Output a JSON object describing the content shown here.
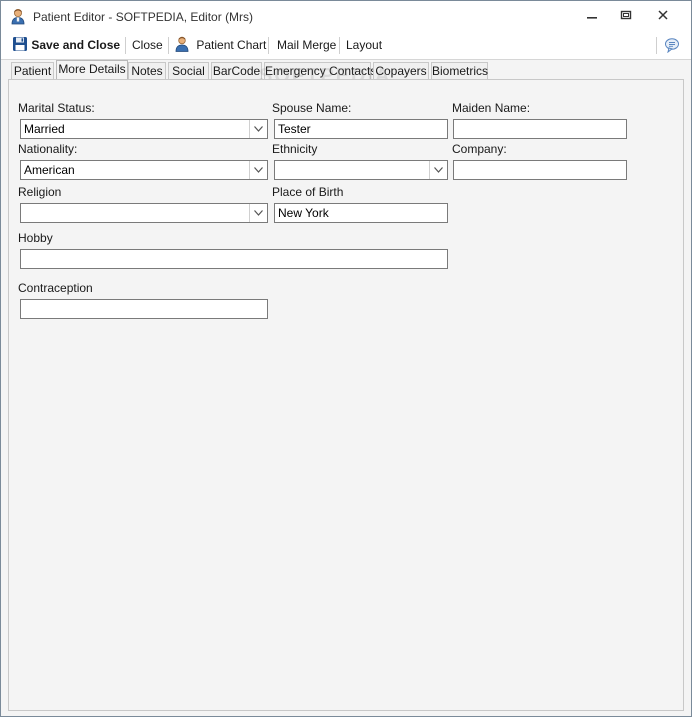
{
  "window": {
    "title": "Patient Editor - SOFTPEDIA, Editor (Mrs)",
    "minimize": "—",
    "restore": "⧉",
    "close": "✕"
  },
  "toolbar": {
    "save_close_label": "Save and Close",
    "close_label": "Close",
    "patient_chart_label": "Patient Chart",
    "mail_merge_label": "Mail Merge",
    "layout_label": "Layout"
  },
  "tabs": [
    {
      "label": "Patient"
    },
    {
      "label": "More Details"
    },
    {
      "label": "Notes"
    },
    {
      "label": "Social"
    },
    {
      "label": "BarCode"
    },
    {
      "label": "Emergency Contacts"
    },
    {
      "label": "Copayers"
    },
    {
      "label": "Biometrics"
    }
  ],
  "active_tab": "More Details",
  "watermark": "SOFTPEDIA",
  "form": {
    "marital_status": {
      "label": "Marital Status:",
      "value": "Married"
    },
    "spouse_name": {
      "label": "Spouse Name:",
      "value": "Tester"
    },
    "maiden_name": {
      "label": "Maiden Name:",
      "value": ""
    },
    "nationality": {
      "label": "Nationality:",
      "value": "American"
    },
    "ethnicity": {
      "label": "Ethnicity",
      "value": ""
    },
    "company": {
      "label": "Company:",
      "value": ""
    },
    "religion": {
      "label": "Religion",
      "value": ""
    },
    "place_of_birth": {
      "label": "Place of Birth",
      "value": "New York"
    },
    "hobby": {
      "label": "Hobby",
      "value": ""
    },
    "contraception": {
      "label": "Contraception",
      "value": ""
    }
  },
  "colors": {
    "accent": "#2a6db5",
    "border": "#7a7a7a",
    "panel_bg": "#f4f4f4"
  }
}
